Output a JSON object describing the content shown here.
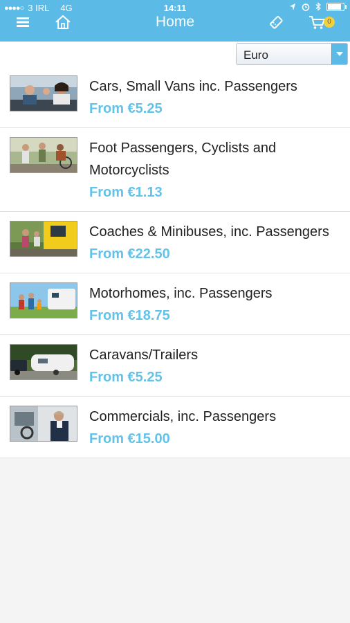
{
  "status": {
    "carrier": "3 IRL",
    "network": "4G",
    "time": "14:11"
  },
  "header": {
    "title": "Home",
    "cart_count": "0",
    "icons": [
      "menu-icon",
      "home-icon",
      "ticket-icon",
      "cart-icon"
    ]
  },
  "currency": {
    "selected": "Euro"
  },
  "categories": [
    {
      "label": "Cars, Small Vans inc. Passengers",
      "price": "From €5.25",
      "image": "car-passengers-photo"
    },
    {
      "label_line1": "Foot Passengers, Cyclists and",
      "label_line2": "Motorcyclists",
      "price": "From €1.13",
      "image": "cyclists-photo"
    },
    {
      "label": "Coaches & Minibuses, inc. Passengers",
      "price": "From €22.50",
      "image": "minibus-photo"
    },
    {
      "label": "Motorhomes, inc. Passengers",
      "price": "From €18.75",
      "image": "motorhome-photo"
    },
    {
      "label": "Caravans/Trailers",
      "price": "From €5.25",
      "image": "caravan-photo"
    },
    {
      "label": "Commercials, inc. Passengers",
      "price": "From €15.00",
      "image": "commercial-van-photo"
    }
  ],
  "colors": {
    "accent": "#5bbbe6",
    "price": "#63c2e8",
    "badge": "#f4d03f"
  }
}
